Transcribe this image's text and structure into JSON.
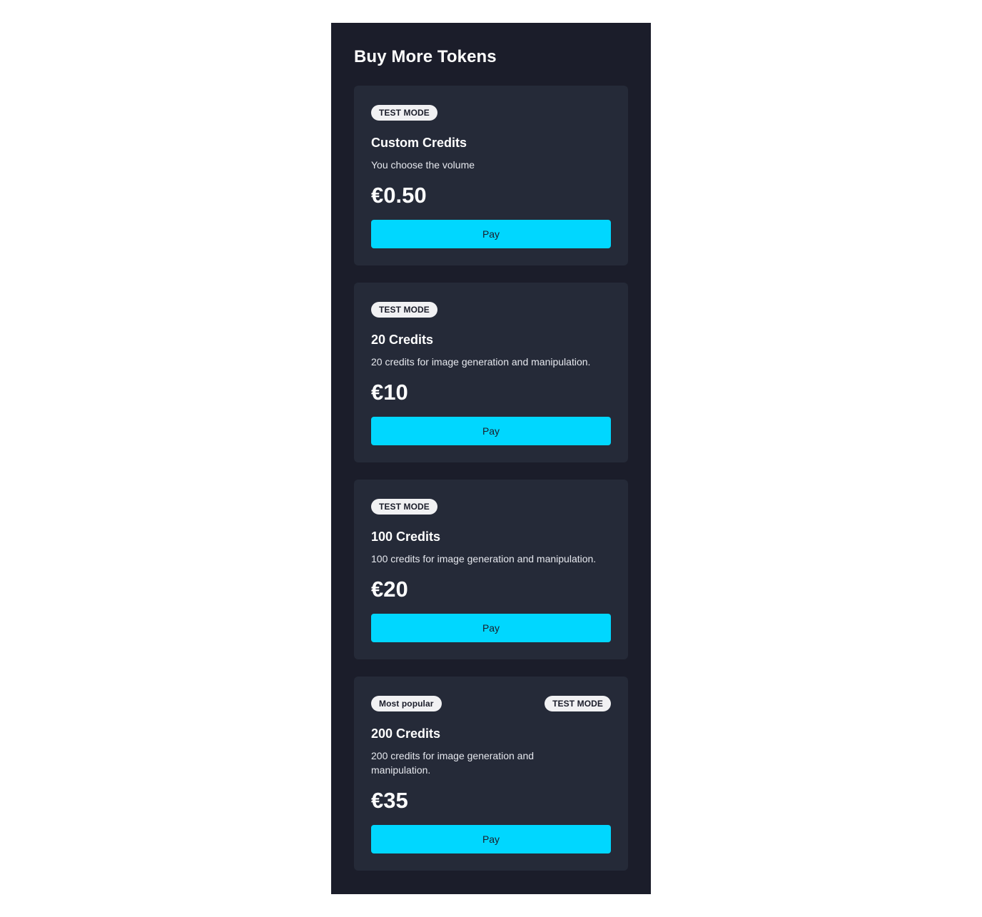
{
  "panel": {
    "title": "Buy More Tokens"
  },
  "cards": [
    {
      "badge_left": "TEST MODE",
      "name": "Custom Credits",
      "description": "You choose the volume",
      "price": "€0.50",
      "button_label": "Pay"
    },
    {
      "badge_left": "TEST MODE",
      "name": "20 Credits",
      "description": "20 credits for image generation and manipulation.",
      "price": "€10",
      "button_label": "Pay"
    },
    {
      "badge_left": "TEST MODE",
      "name": "100 Credits",
      "description": "100 credits for image generation and manipulation.",
      "price": "€20",
      "button_label": "Pay"
    },
    {
      "badge_left": "Most popular",
      "badge_right": "TEST MODE",
      "name": "200 Credits",
      "description": "200 credits for image generation and manipulation.",
      "price": "€35",
      "button_label": "Pay"
    }
  ],
  "colors": {
    "panel_background": "#1b1d2a",
    "card_background": "#252a38",
    "accent": "#00d7ff",
    "badge_background": "#f1f1f3"
  }
}
